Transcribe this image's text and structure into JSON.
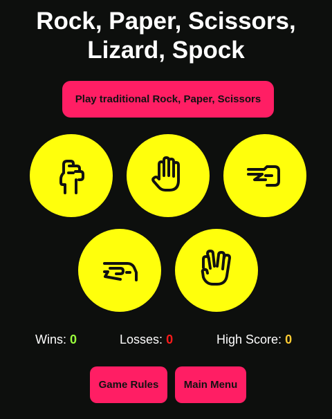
{
  "title": {
    "line1": "Rock, Paper, Scissors,",
    "line2": "Lizard, Spock"
  },
  "mode_button": "Play traditional Rock, Paper, Scissors",
  "choices": [
    {
      "name": "rock",
      "icon": "fist-hand-icon"
    },
    {
      "name": "paper",
      "icon": "open-hand-icon"
    },
    {
      "name": "scissors",
      "icon": "scissors-hand-icon"
    },
    {
      "name": "lizard",
      "icon": "lizard-hand-icon"
    },
    {
      "name": "spock",
      "icon": "vulcan-salute-hand-icon"
    }
  ],
  "stats": {
    "wins_label": "Wins:",
    "wins": "0",
    "losses_label": "Losses:",
    "losses": "0",
    "high_label": "High Score:",
    "high": "0"
  },
  "buttons": {
    "rules": "Game Rules",
    "menu": "Main Menu"
  },
  "colors": {
    "background": "#0d0f0d",
    "accent": "#ff1e64",
    "choice": "#ffff0c",
    "wins": "#9aff3c",
    "losses": "#ff1a1a",
    "high": "#ffcc33"
  }
}
